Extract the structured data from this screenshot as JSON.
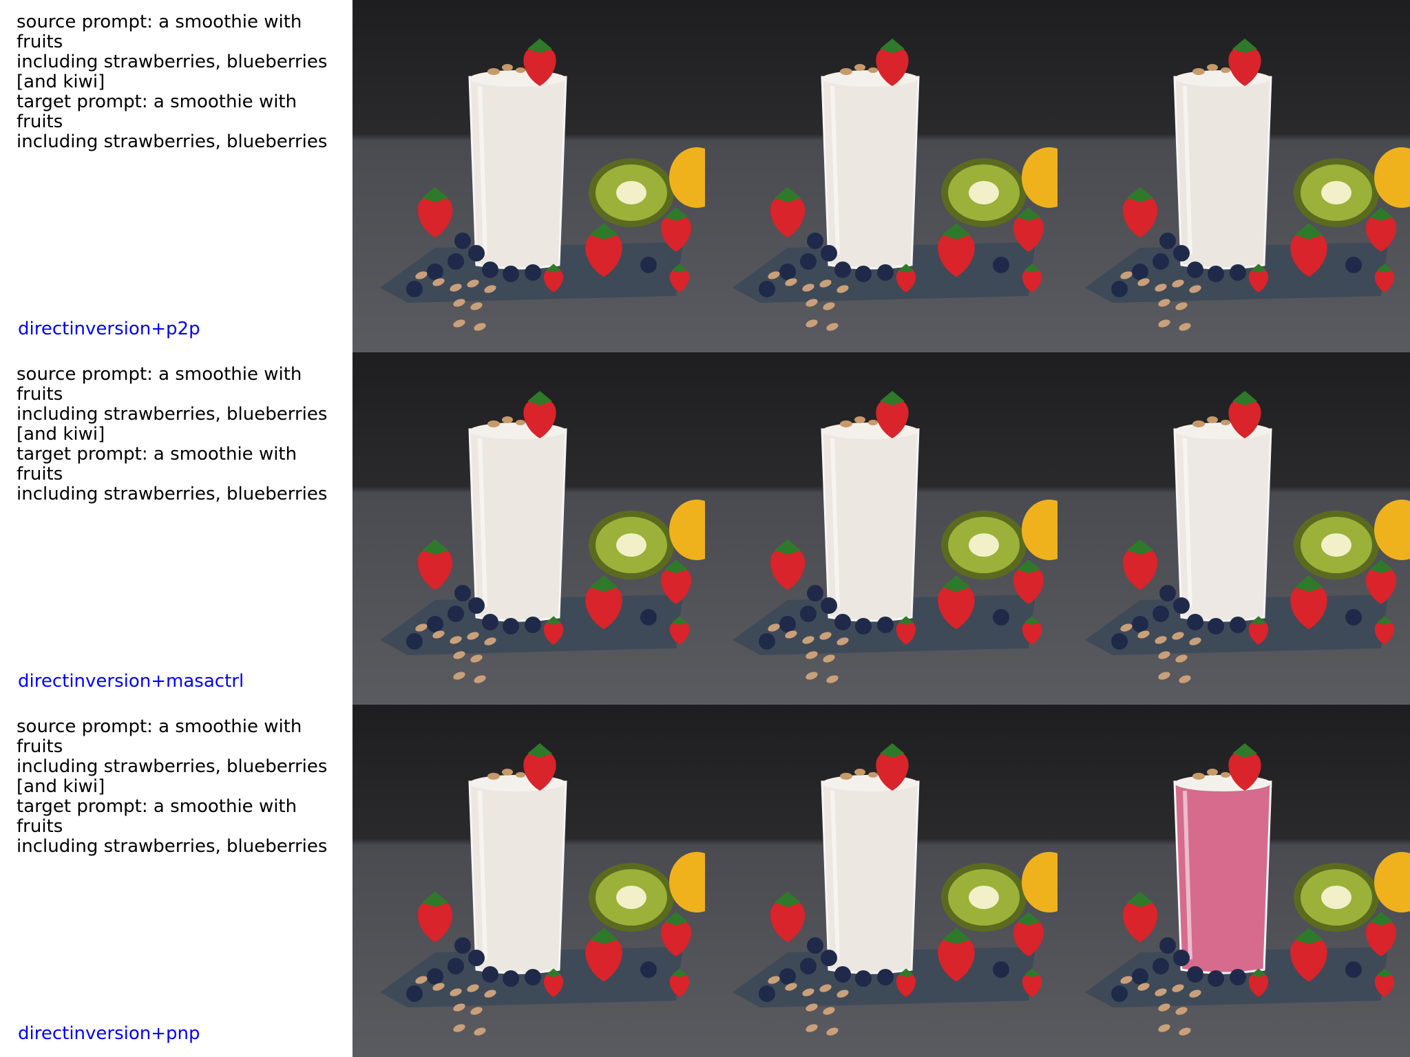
{
  "rows": [
    {
      "prompt_lines": [
        "source prompt: a smoothie with fruits",
        "including strawberries, blueberries",
        "[and kiwi]",
        "target prompt: a smoothie with fruits",
        "including strawberries, blueberries"
      ],
      "method": "directinversion+p2p",
      "images": [
        {
          "smoothie_color": "#ece7e1",
          "has_kiwi": true
        },
        {
          "smoothie_color": "#ece7e1",
          "has_kiwi": true
        },
        {
          "smoothie_color": "#ebe6e0",
          "has_kiwi": true
        }
      ]
    },
    {
      "prompt_lines": [
        "source prompt: a smoothie with fruits",
        "including strawberries, blueberries",
        "[and kiwi]",
        "target prompt: a smoothie with fruits",
        "including strawberries, blueberries"
      ],
      "method": "directinversion+masactrl",
      "images": [
        {
          "smoothie_color": "#ece7e1",
          "has_kiwi": true
        },
        {
          "smoothie_color": "#ece7e1",
          "has_kiwi": true
        },
        {
          "smoothie_color": "#ede8e3",
          "has_kiwi": true
        }
      ]
    },
    {
      "prompt_lines": [
        "source prompt: a smoothie with fruits",
        "including strawberries, blueberries",
        "[and kiwi]",
        "target prompt: a smoothie with fruits",
        "including strawberries, blueberries"
      ],
      "method": "directinversion+pnp",
      "images": [
        {
          "smoothie_color": "#ece7e1",
          "has_kiwi": true
        },
        {
          "smoothie_color": "#ece7e1",
          "has_kiwi": true
        },
        {
          "smoothie_color": "#d66b8e",
          "has_kiwi": true
        }
      ]
    }
  ],
  "colors": {
    "background": "#ffffff",
    "prompt_text": "#000000",
    "method_label": "#0000ff",
    "photo_backdrop": "#2a2a2c",
    "table_surface": "#5a5b60",
    "napkin": "#3e4a57",
    "strawberry": "#d8242a",
    "blueberry": "#1f2a4a",
    "kiwi_flesh": "#9bb13a",
    "lemon": "#f0b21c"
  }
}
